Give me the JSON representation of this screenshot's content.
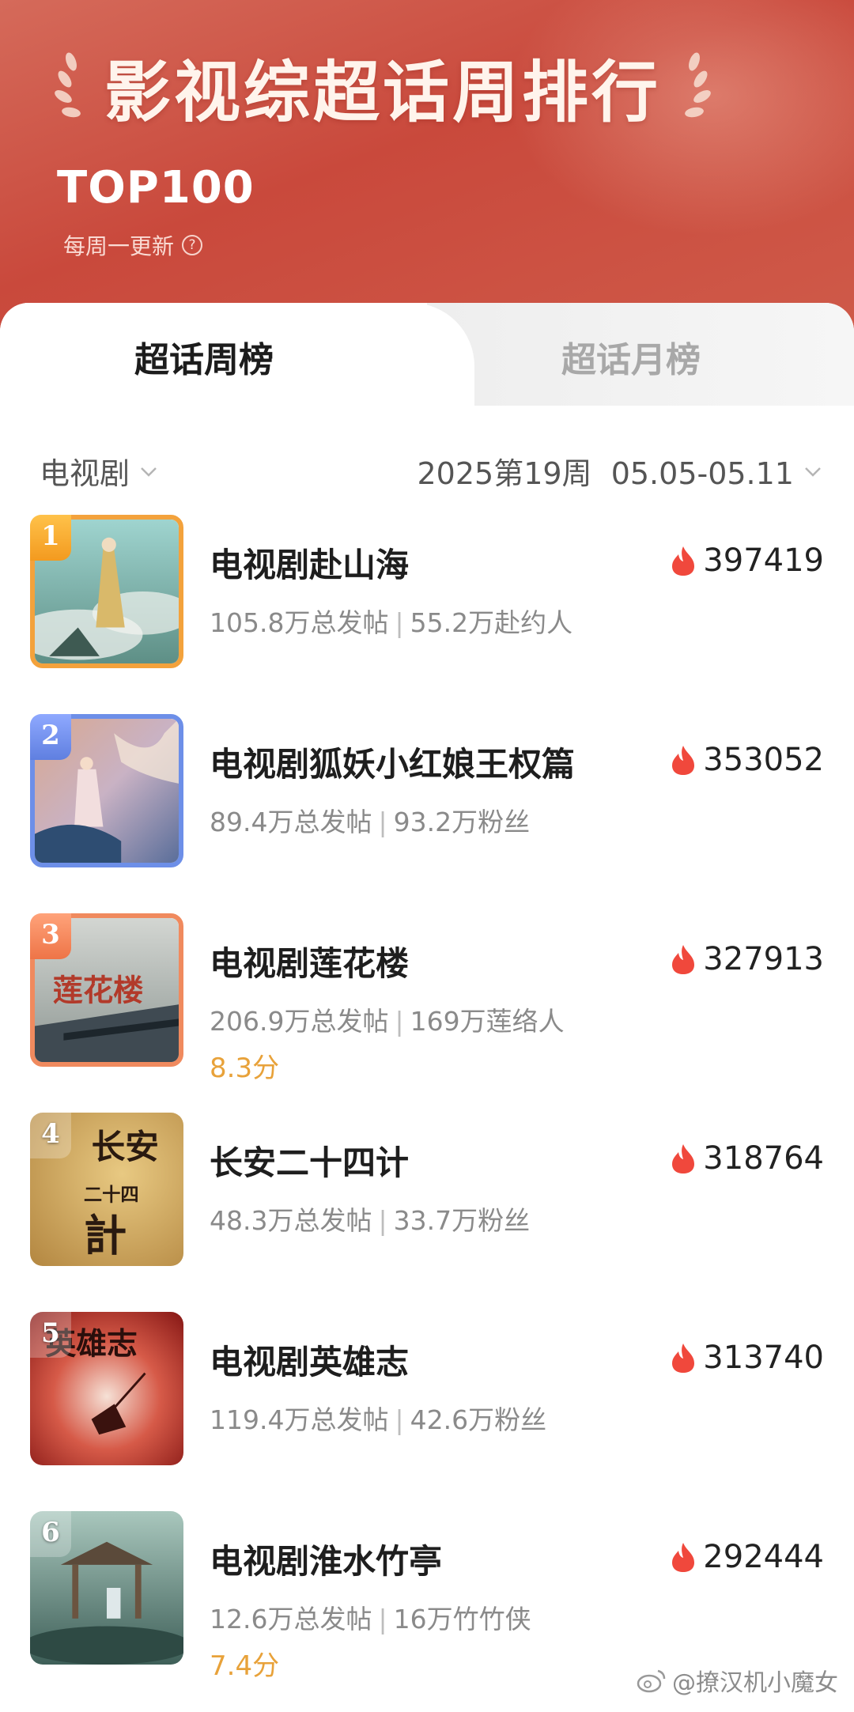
{
  "header": {
    "title": "影视综超话周排行",
    "subtitle": "TOP100",
    "update_note": "每周一更新",
    "help_icon": "?"
  },
  "tabs": [
    {
      "label": "超话周榜",
      "active": true
    },
    {
      "label": "超话月榜",
      "active": false
    }
  ],
  "filters": {
    "category": "电视剧",
    "period": "2025第19周  05.05-05.11"
  },
  "items": [
    {
      "rank": "1",
      "name": "电视剧赴山海",
      "posts": "105.8万总发帖",
      "followers": "55.2万赴约人",
      "score": "",
      "heat": "397419"
    },
    {
      "rank": "2",
      "name": "电视剧狐妖小红娘王权篇",
      "posts": "89.4万总发帖",
      "followers": "93.2万粉丝",
      "score": "",
      "heat": "353052"
    },
    {
      "rank": "3",
      "name": "电视剧莲花楼",
      "posts": "206.9万总发帖",
      "followers": "169万莲络人",
      "score": "8.3分",
      "heat": "327913"
    },
    {
      "rank": "4",
      "name": "长安二十四计",
      "posts": "48.3万总发帖",
      "followers": "33.7万粉丝",
      "score": "",
      "heat": "318764"
    },
    {
      "rank": "5",
      "name": "电视剧英雄志",
      "posts": "119.4万总发帖",
      "followers": "42.6万粉丝",
      "score": "",
      "heat": "313740"
    },
    {
      "rank": "6",
      "name": "电视剧淮水竹亭",
      "posts": "12.6万总发帖",
      "followers": "16万竹竹侠",
      "score": "7.4分",
      "heat": "292444"
    }
  ],
  "cover_texts": {
    "cover3": "莲花楼",
    "cover4_top": "长安",
    "cover4_mid": "二十四",
    "cover4_bottom": "計",
    "cover5": "英雄志"
  },
  "watermark": "@撩汉机小魔女",
  "colors": {
    "header_red": "#c9493c",
    "score_orange": "#e8a23a",
    "flame_red": "#f0483c"
  }
}
